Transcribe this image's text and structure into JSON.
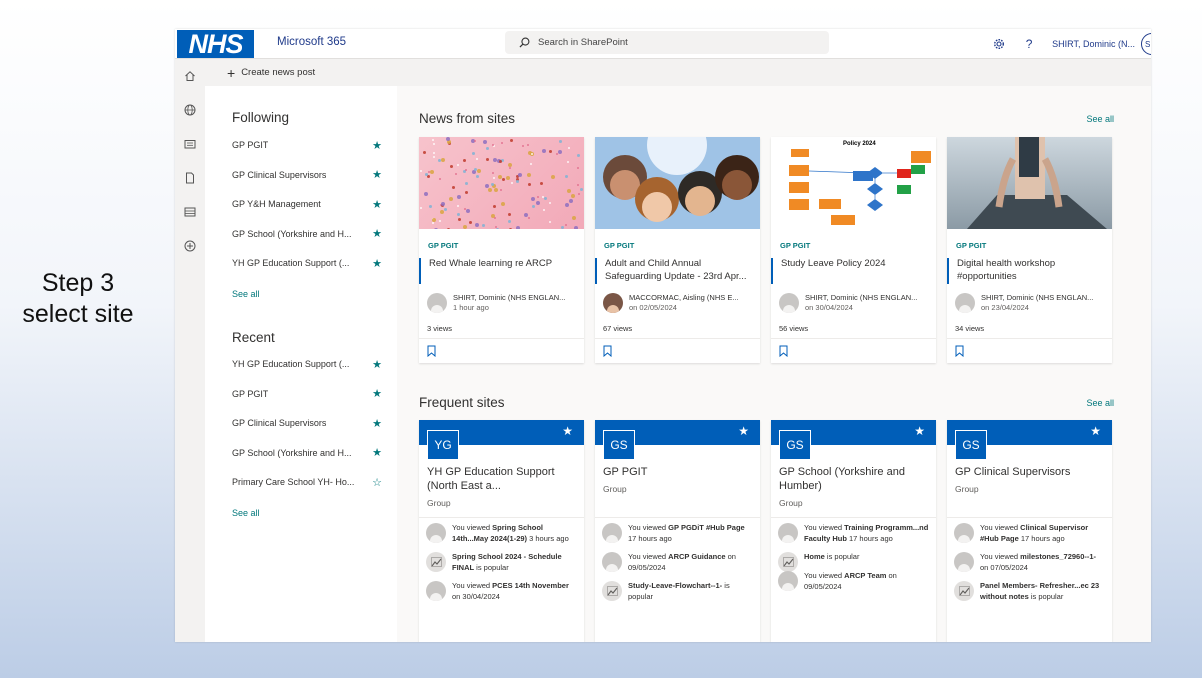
{
  "caption": {
    "line1": "Step 3",
    "line2": "select site"
  },
  "topbar": {
    "logo_text": "NHS",
    "suite_name": "Microsoft 365",
    "search_placeholder": "Search in SharePoint",
    "help_label": "?",
    "user_name": "SHIRT, Dominic (N...",
    "user_initials": "SH"
  },
  "appbar": {
    "icons": [
      "home-icon",
      "globe-icon",
      "news-icon",
      "file-icon",
      "list-icon",
      "add-icon"
    ]
  },
  "command": {
    "create_news": "Create news post"
  },
  "left": {
    "following_heading": "Following",
    "following": [
      {
        "name": "GP PGIT",
        "starred": true
      },
      {
        "name": "GP Clinical Supervisors",
        "starred": true
      },
      {
        "name": "GP Y&H Management",
        "starred": true
      },
      {
        "name": "GP School (Yorkshire and H...",
        "starred": true
      },
      {
        "name": "YH GP Education Support (...",
        "starred": true
      }
    ],
    "following_see_all": "See all",
    "recent_heading": "Recent",
    "recent": [
      {
        "name": "YH GP Education Support (...",
        "starred": true
      },
      {
        "name": "GP PGIT",
        "starred": true
      },
      {
        "name": "GP Clinical Supervisors",
        "starred": true
      },
      {
        "name": "GP School (Yorkshire and H...",
        "starred": true
      },
      {
        "name": "Primary Care School YH- Ho...",
        "starred": false
      }
    ],
    "recent_see_all": "See all"
  },
  "news": {
    "heading": "News from sites",
    "see_all": "See all",
    "cards": [
      {
        "site": "GP PGIT",
        "title": "Red Whale learning re ARCP",
        "author": "SHIRT, Dominic (NHS ENGLAN...",
        "date": "1 hour ago",
        "views": "3 views"
      },
      {
        "site": "GP PGIT",
        "title": "Adult and Child Annual Safeguarding Update - 23rd Apr...",
        "author": "MACCORMAC, Aisling (NHS E...",
        "date": "on 02/05/2024",
        "views": "67 views"
      },
      {
        "site": "GP PGIT",
        "title": "Study Leave Policy 2024",
        "author": "SHIRT, Dominic (NHS ENGLAN...",
        "date": "on 30/04/2024",
        "views": "56 views",
        "image_caption": "Policy 2024"
      },
      {
        "site": "GP PGIT",
        "title": "Digital health workshop #opportunities",
        "author": "SHIRT, Dominic (NHS ENGLAN...",
        "date": "on 23/04/2024",
        "views": "34 views"
      }
    ]
  },
  "frequent": {
    "heading": "Frequent sites",
    "see_all": "See all",
    "cards": [
      {
        "initials": "YG",
        "title": "YH GP Education Support (North East a...",
        "type": "Group",
        "activities": [
          {
            "kind": "person",
            "pre": "You viewed ",
            "bold": "Spring School 14th...May 2024(1-29)",
            "post": " 3 hours ago"
          },
          {
            "kind": "trend",
            "pre": "",
            "bold": "Spring School 2024 - Schedule FINAL",
            "post": " is popular"
          },
          {
            "kind": "person",
            "pre": "You viewed ",
            "bold": "PCES 14th November",
            "post": " on 30/04/2024"
          }
        ]
      },
      {
        "initials": "GS",
        "title": "GP PGIT",
        "type": "Group",
        "activities": [
          {
            "kind": "person",
            "pre": "You viewed ",
            "bold": "GP PGDiT #Hub Page",
            "post": " 17 hours ago"
          },
          {
            "kind": "person",
            "pre": "You viewed ",
            "bold": "ARCP Guidance",
            "post": " on 09/05/2024"
          },
          {
            "kind": "trend",
            "pre": "",
            "bold": "Study-Leave-Flowchart--1-",
            "post": " is popular"
          }
        ]
      },
      {
        "initials": "GS",
        "title": "GP School (Yorkshire and Humber)",
        "type": "Group",
        "activities": [
          {
            "kind": "person",
            "pre": "You viewed ",
            "bold": "Training Programm...nd Faculty Hub",
            "post": " 17 hours ago"
          },
          {
            "kind": "trend",
            "pre": "",
            "bold": "Home",
            "post": " is popular"
          },
          {
            "kind": "person",
            "pre": "You viewed ",
            "bold": "ARCP Team",
            "post": " on 09/05/2024"
          }
        ]
      },
      {
        "initials": "GS",
        "title": "GP Clinical Supervisors",
        "type": "Group",
        "activities": [
          {
            "kind": "person",
            "pre": "You viewed ",
            "bold": "Clinical Supervisor #Hub Page",
            "post": " 17 hours ago"
          },
          {
            "kind": "person",
            "pre": "You viewed ",
            "bold": "milestones_72960--1-",
            "post": " on 07/05/2024"
          },
          {
            "kind": "trend",
            "pre": "",
            "bold": "Panel Members- Refresher...ec 23 without notes",
            "post": " is popular"
          }
        ]
      }
    ]
  },
  "colors": {
    "nhs_blue": "#005eb8",
    "accent_teal": "#03787c",
    "suite_text": "#1f3a8a"
  }
}
